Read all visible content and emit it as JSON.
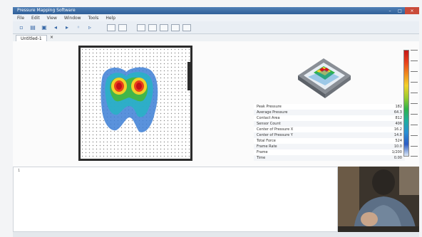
{
  "window": {
    "title": "Pressure Mapping Software"
  },
  "menu": {
    "items": [
      "File",
      "Edit",
      "View",
      "Window",
      "Tools",
      "Help"
    ]
  },
  "tab": {
    "label": "Untitled-1",
    "close": "×"
  },
  "stats": {
    "rows": [
      {
        "label": "Peak Pressure",
        "value": "182"
      },
      {
        "label": "Average Pressure",
        "value": "64.3"
      },
      {
        "label": "Contact Area",
        "value": "812"
      },
      {
        "label": "Sensor Count",
        "value": "406"
      },
      {
        "label": "Center of Pressure X",
        "value": "16.2"
      },
      {
        "label": "Center of Pressure Y",
        "value": "14.8"
      },
      {
        "label": "Total Force",
        "value": "524"
      },
      {
        "label": "Frame Rate",
        "value": "10.0"
      },
      {
        "label": "Frame",
        "value": "1/200"
      },
      {
        "label": "Time",
        "value": "0.00"
      }
    ]
  },
  "lower": {
    "label": "1"
  },
  "colors": {
    "title": "#2f5f99",
    "frame": "#2b2b2b"
  }
}
